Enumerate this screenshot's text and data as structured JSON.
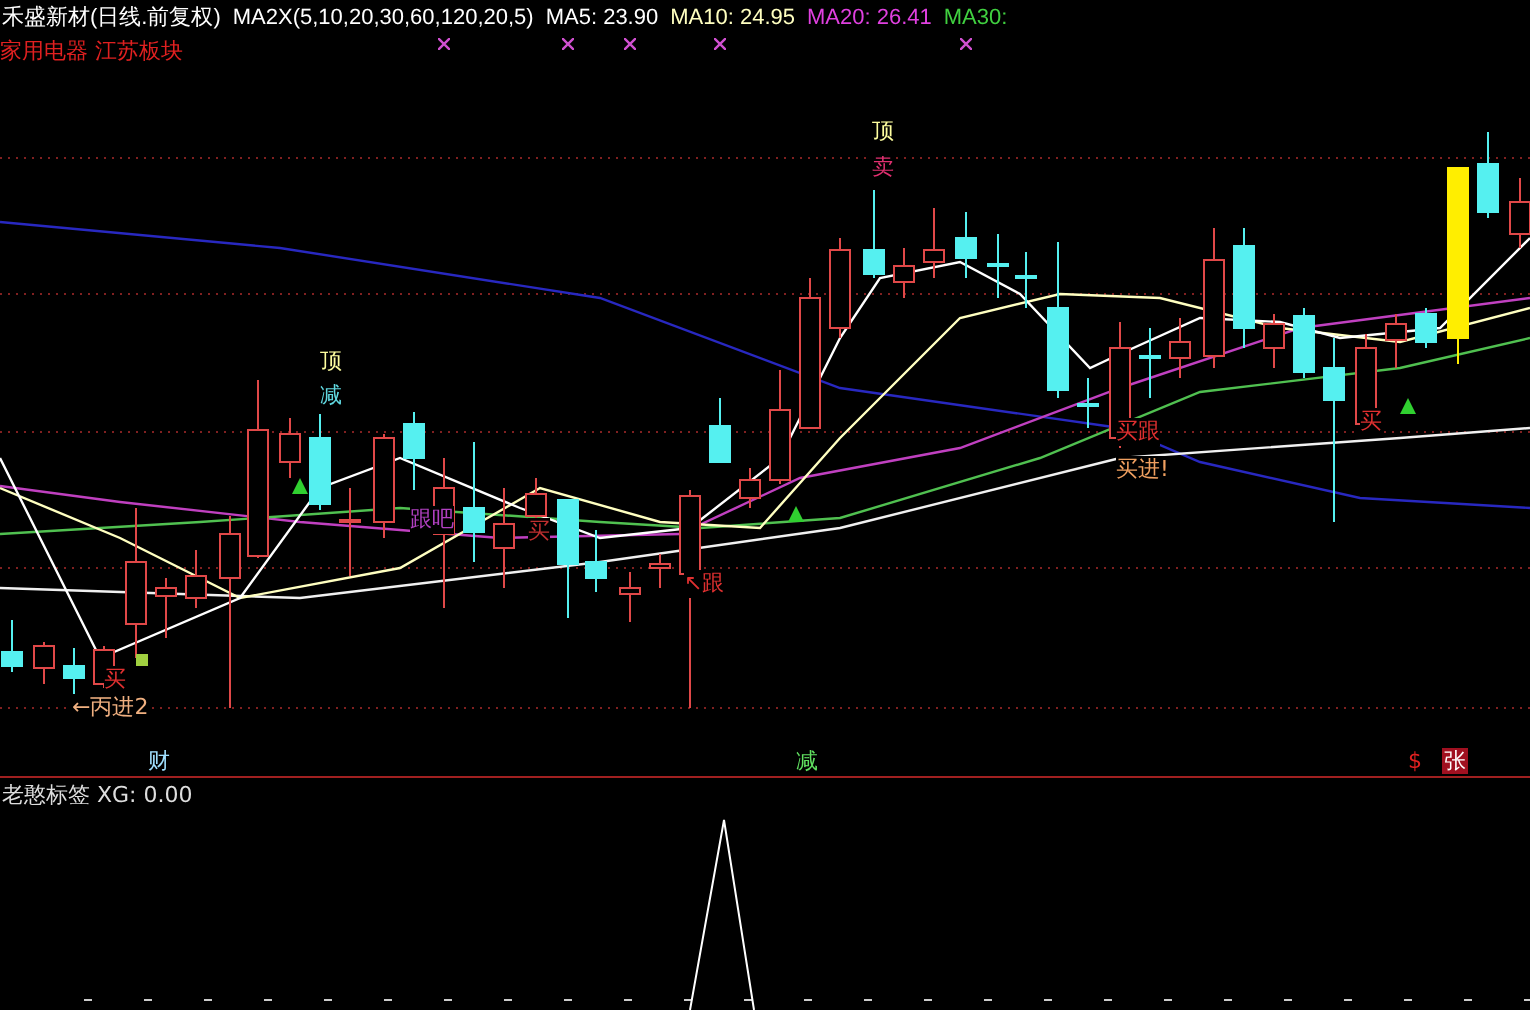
{
  "header": {
    "title": "禾盛新材(日线.前复权)",
    "indicator": "MA2X(5,10,20,30,60,120,20,5)",
    "averages": [
      {
        "label": "MA5: 23.90",
        "color": "#ffffff"
      },
      {
        "label": "MA10: 24.95",
        "color": "#ffffc0"
      },
      {
        "label": "MA20: 26.41",
        "color": "#e040e0"
      },
      {
        "label": "MA30:",
        "color": "#40d040"
      }
    ],
    "sectors": "家用电器 江苏板块"
  },
  "chart_labels": [
    {
      "text": "顶",
      "color": "#ffffa0"
    },
    {
      "text": "减",
      "color": "#60d8e0"
    },
    {
      "text": "买",
      "color": "#e03030"
    },
    {
      "text": "←丙进2",
      "color": "#f0b080"
    },
    {
      "text": "跟吧",
      "color": "#b040c0"
    },
    {
      "text": "买",
      "color": "#c03030"
    },
    {
      "text": "↖跟",
      "color": "#e03030"
    },
    {
      "text": "顶",
      "color": "#ffffa0"
    },
    {
      "text": "卖",
      "color": "#e03070"
    },
    {
      "text": "买跟",
      "color": "#e03030"
    },
    {
      "text": "买进!",
      "color": "#f0a060"
    },
    {
      "text": "买",
      "color": "#e03030"
    }
  ],
  "marker_strip": [
    {
      "text": "财",
      "kind": "plain",
      "color": "#a0e0ff"
    },
    {
      "text": "减",
      "kind": "plain",
      "color": "#60e060"
    },
    {
      "text": "$",
      "kind": "plain",
      "color": "#e02020"
    },
    {
      "text": "张",
      "kind": "badge",
      "color": "#a01020"
    }
  ],
  "sub_panel": {
    "label": "老憨标签 XG: 0.00"
  }
}
